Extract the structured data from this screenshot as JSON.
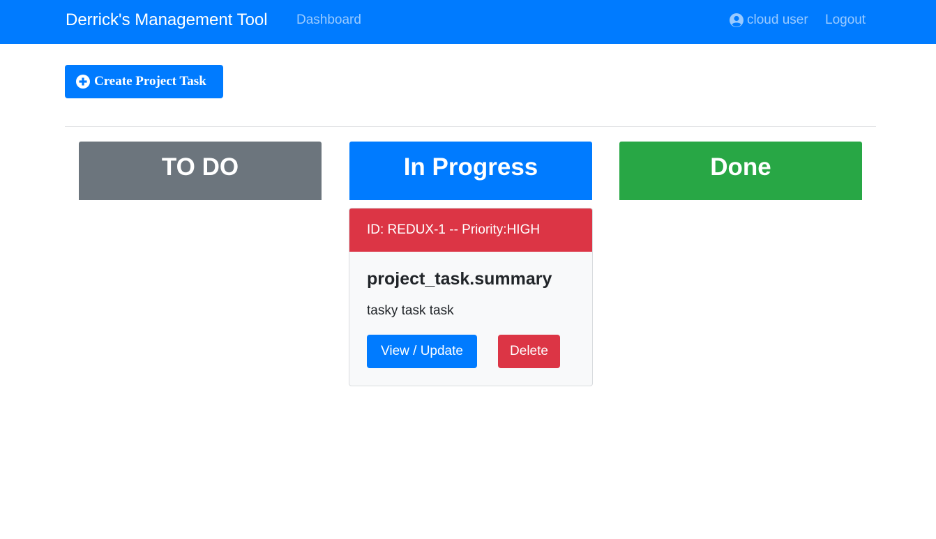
{
  "navbar": {
    "brand": "Derrick's Management Tool",
    "dashboard_label": "Dashboard",
    "user_label": "cloud user",
    "user_icon": "user-circle-icon",
    "logout_label": "Logout"
  },
  "toolbar": {
    "create_label": "Create Project Task",
    "create_icon": "plus-circle-icon"
  },
  "board": {
    "columns": [
      {
        "title": "TO DO",
        "color": "#6c757d"
      },
      {
        "title": "In Progress",
        "color": "#007bff"
      },
      {
        "title": "Done",
        "color": "#28a745"
      }
    ]
  },
  "tasks": [
    {
      "header": "ID: REDUX-1 -- Priority:HIGH",
      "header_color": "#dc3545",
      "summary": "project_task.summary",
      "description": "tasky task task",
      "view_label": "View / Update",
      "delete_label": "Delete"
    }
  ],
  "colors": {
    "primary": "#007bff",
    "secondary": "#6c757d",
    "success": "#28a745",
    "danger": "#dc3545"
  }
}
